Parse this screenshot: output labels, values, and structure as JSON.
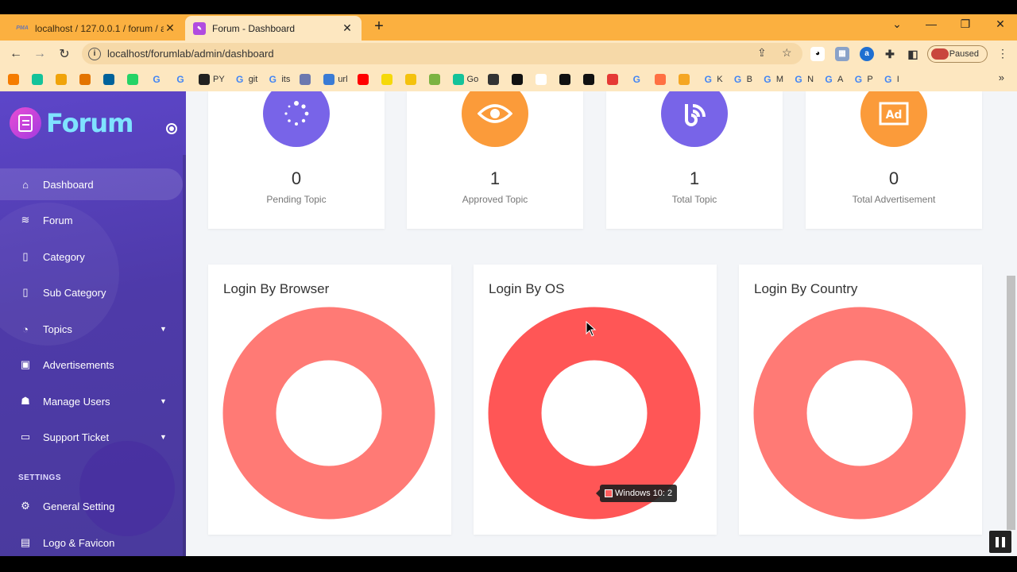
{
  "browser": {
    "tabs": [
      {
        "title": "localhost / 127.0.0.1 / forum / ad",
        "favicon": "PMA"
      },
      {
        "title": "Forum - Dashboard",
        "active": true
      }
    ],
    "url": "localhost/forumlab/admin/dashboard",
    "profile_status": "Paused",
    "bookmarks": [
      {
        "label": "",
        "icon": "arrow-icon"
      },
      {
        "label": "",
        "icon": "grammarly-icon"
      },
      {
        "label": "",
        "icon": "puzzle-icon"
      },
      {
        "label": "",
        "icon": "chart-icon"
      },
      {
        "label": "",
        "icon": "ieee-icon"
      },
      {
        "label": "",
        "icon": "whatsapp-icon"
      },
      {
        "label": "",
        "icon": "google-icon"
      },
      {
        "label": "",
        "icon": "google-icon"
      },
      {
        "label": "PY",
        "icon": "github-icon"
      },
      {
        "label": "git",
        "icon": "google-icon"
      },
      {
        "label": "its",
        "icon": "google-icon"
      },
      {
        "label": "",
        "icon": "pma-icon"
      },
      {
        "label": "url",
        "icon": "wave-icon"
      },
      {
        "label": "",
        "icon": "youtube-icon"
      },
      {
        "label": "",
        "icon": "p-icon"
      },
      {
        "label": "",
        "icon": "folder-icon"
      },
      {
        "label": "",
        "icon": "circle-icon"
      },
      {
        "label": "Go",
        "icon": "grammarly-icon"
      },
      {
        "label": "",
        "icon": "box-icon"
      },
      {
        "label": "",
        "icon": "cl-icon"
      },
      {
        "label": "",
        "icon": "figure-icon"
      },
      {
        "label": "",
        "icon": "black-circle-icon"
      },
      {
        "label": "",
        "icon": "black-circle-icon"
      },
      {
        "label": "",
        "icon": "red-circle-icon"
      },
      {
        "label": "",
        "icon": "google-icon"
      },
      {
        "label": "",
        "icon": "triangle-icon"
      },
      {
        "label": "",
        "icon": "bee-icon"
      },
      {
        "label": "K",
        "icon": "google-icon"
      },
      {
        "label": "B",
        "icon": "google-icon"
      },
      {
        "label": "M",
        "icon": "google-icon"
      },
      {
        "label": "N",
        "icon": "google-icon"
      },
      {
        "label": "A",
        "icon": "google-icon"
      },
      {
        "label": "P",
        "icon": "google-icon"
      },
      {
        "label": "I",
        "icon": "google-icon"
      }
    ]
  },
  "sidebar": {
    "brand": "Forum",
    "items": [
      {
        "label": "Dashboard",
        "icon": "home-icon",
        "active": true
      },
      {
        "label": "Forum",
        "icon": "layers-icon"
      },
      {
        "label": "Category",
        "icon": "clipboard-icon"
      },
      {
        "label": "Sub Category",
        "icon": "clipboard-icon"
      },
      {
        "label": "Topics",
        "icon": "rss-icon",
        "has_children": true
      },
      {
        "label": "Advertisements",
        "icon": "ad-icon"
      },
      {
        "label": "Manage Users",
        "icon": "users-icon",
        "has_children": true
      },
      {
        "label": "Support Ticket",
        "icon": "ticket-icon",
        "has_children": true
      }
    ],
    "settings_label": "SETTINGS",
    "settings_items": [
      {
        "label": "General Setting",
        "icon": "gear-icon"
      },
      {
        "label": "Logo & Favicon",
        "icon": "image-icon"
      }
    ]
  },
  "stats": [
    {
      "value": "0",
      "label": "Pending Topic",
      "color": "#7864e8",
      "icon": "spinner-icon"
    },
    {
      "value": "1",
      "label": "Approved Topic",
      "color": "#fb9b3a",
      "icon": "eye-icon"
    },
    {
      "value": "1",
      "label": "Total Topic",
      "color": "#7864e8",
      "icon": "rss-icon"
    },
    {
      "value": "0",
      "label": "Total Advertisement",
      "color": "#fb9b3a",
      "icon": "ad-icon"
    }
  ],
  "charts": [
    {
      "title": "Login By Browser",
      "color": "#ff7a75"
    },
    {
      "title": "Login By OS",
      "color": "#ff5656"
    },
    {
      "title": "Login By Country",
      "color": "#ff7a75"
    }
  ],
  "chart_data": [
    {
      "type": "pie",
      "title": "Login By Browser",
      "labels": [],
      "values": []
    },
    {
      "type": "pie",
      "title": "Login By OS",
      "labels": [
        "Windows 10"
      ],
      "values": [
        2
      ]
    },
    {
      "type": "pie",
      "title": "Login By Country",
      "labels": [],
      "values": []
    }
  ],
  "tooltip": {
    "text": "Windows 10: 2"
  }
}
